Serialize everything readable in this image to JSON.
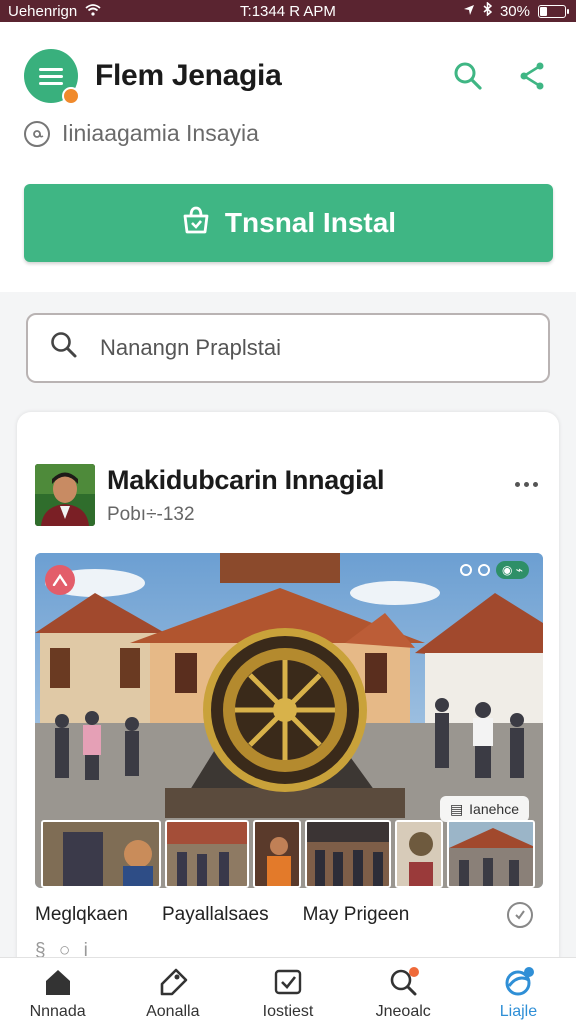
{
  "status_bar": {
    "carrier": "Uehenrign",
    "time": "T:1344 R APM",
    "battery": "30%",
    "battery_level": 0.3
  },
  "header": {
    "app_title": "Flem Jenagia",
    "subtitle": "Iiniaagamia Insayia",
    "icons": {
      "search": "search-icon",
      "share": "share-icon",
      "menu": "menu-icon"
    }
  },
  "install_button": {
    "label": "Tnsnal Instal",
    "icon": "store-icon"
  },
  "search": {
    "placeholder": "Nanangn Praplstai",
    "value": ""
  },
  "post": {
    "author": "Makidubcarin Innagial",
    "meta": "Pobı÷-132",
    "photo_chip": "Ianehce",
    "tags": [
      "Meglqkaen",
      "Payallalsaes",
      "May Prigeen"
    ],
    "footer_stub": "§ ○ i"
  },
  "bottom_nav": [
    {
      "label": "Nnnada",
      "icon": "home-icon",
      "active": false
    },
    {
      "label": "Aonalla",
      "icon": "tag-icon",
      "active": false
    },
    {
      "label": "Iostiest",
      "icon": "checkbox-icon",
      "active": false
    },
    {
      "label": "Jneoalc",
      "icon": "search-icon",
      "active": false
    },
    {
      "label": "Liajle",
      "icon": "globe-icon",
      "active": true
    }
  ],
  "colors": {
    "status_bar_bg": "#5a2430",
    "accent_green": "#3fb684",
    "active_blue": "#2f8fd6",
    "badge_orange": "#f08a2c"
  }
}
